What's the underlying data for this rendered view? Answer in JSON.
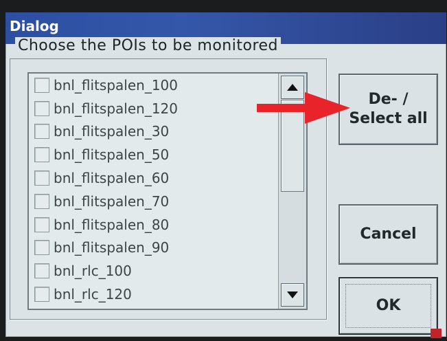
{
  "window": {
    "title": "Dialog"
  },
  "group": {
    "label": "Choose the POIs to be monitored"
  },
  "poi_list": {
    "items": [
      {
        "label": "bnl_flitspalen_100",
        "checked": false
      },
      {
        "label": "bnl_flitspalen_120",
        "checked": false
      },
      {
        "label": "bnl_flitspalen_30",
        "checked": false
      },
      {
        "label": "bnl_flitspalen_50",
        "checked": false
      },
      {
        "label": "bnl_flitspalen_60",
        "checked": false
      },
      {
        "label": "bnl_flitspalen_70",
        "checked": false
      },
      {
        "label": "bnl_flitspalen_80",
        "checked": false
      },
      {
        "label": "bnl_flitspalen_90",
        "checked": false
      },
      {
        "label": "bnl_rlc_100",
        "checked": false
      },
      {
        "label": "bnl_rlc_120",
        "checked": false
      }
    ]
  },
  "buttons": {
    "select_all_line1": "De- /",
    "select_all_line2": "Select all",
    "cancel": "Cancel",
    "ok": "OK"
  },
  "icons": {
    "scroll_up": "triangle-up-icon",
    "scroll_down": "triangle-down-icon",
    "annotation": "red-arrow-icon"
  },
  "colors": {
    "titlebar": "#2c4fa3",
    "dialog_bg": "#dbe3e6",
    "annotation_arrow": "#e8232a"
  }
}
